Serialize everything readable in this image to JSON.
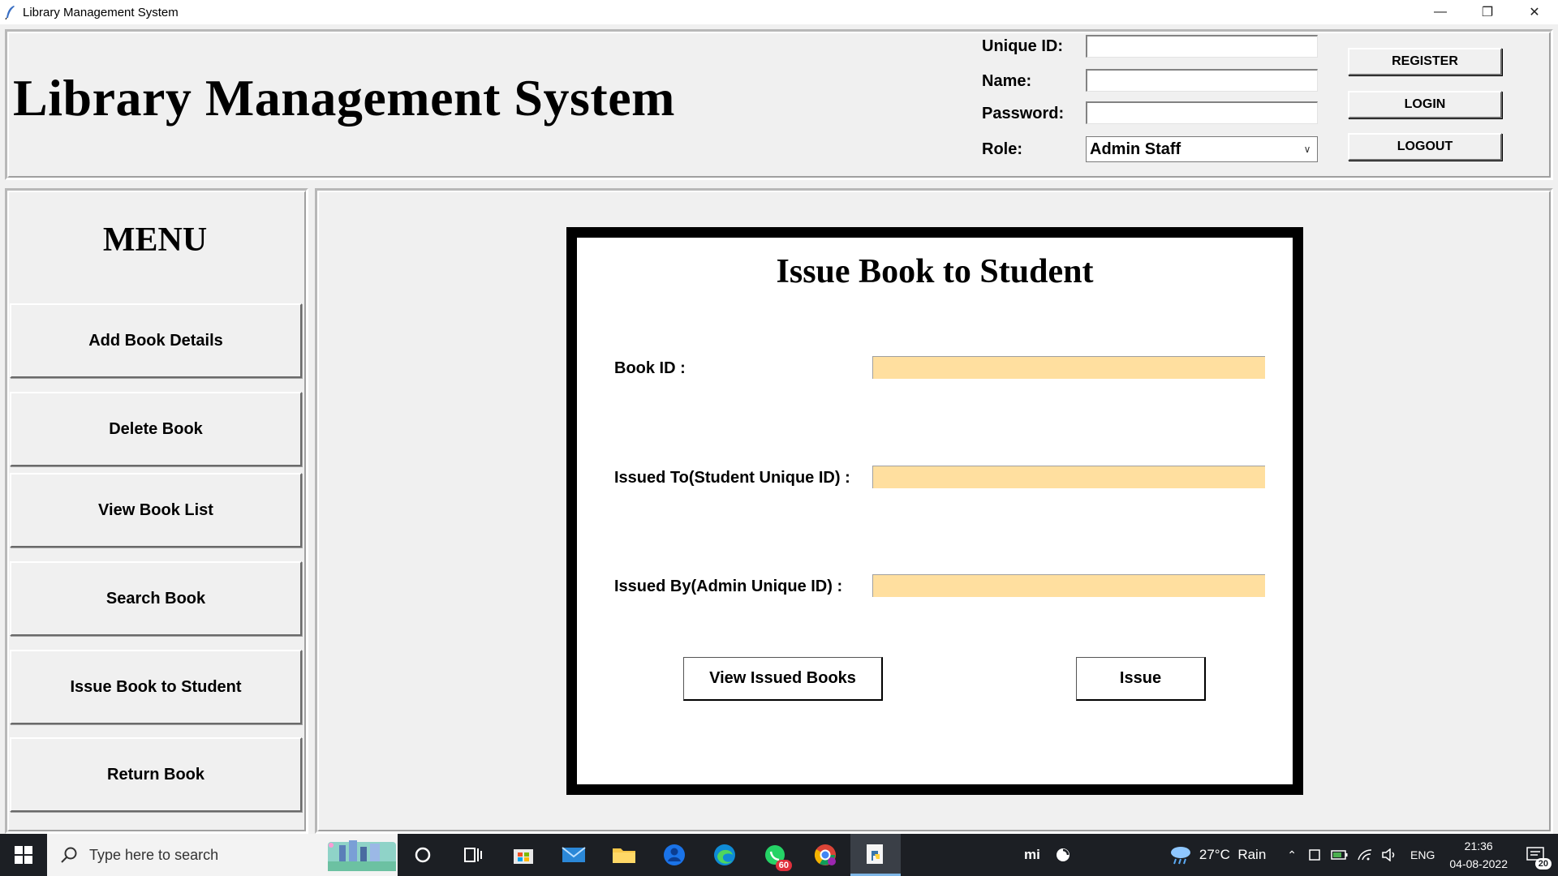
{
  "window": {
    "title": "Library Management System",
    "controls": [
      "—",
      "❐",
      "✕"
    ]
  },
  "header": {
    "app_title": "Library Management System",
    "fields": {
      "unique_id_label": "Unique ID:",
      "unique_id_value": "",
      "name_label": "Name:",
      "name_value": "",
      "password_label": "Password:",
      "password_value": "",
      "role_label": "Role:",
      "role_value": "Admin Staff"
    },
    "buttons": {
      "register": "REGISTER",
      "login": "LOGIN",
      "logout": "LOGOUT"
    }
  },
  "menu": {
    "title": "MENU",
    "items": [
      {
        "label": "Add Book Details"
      },
      {
        "label": "Delete Book"
      },
      {
        "label": "View Book List"
      },
      {
        "label": "Search Book"
      },
      {
        "label": "Issue Book to Student"
      },
      {
        "label": "Return Book"
      }
    ]
  },
  "issue_panel": {
    "title": "Issue Book to Student",
    "book_id_label": "Book ID :",
    "book_id_value": "",
    "issued_to_label": "Issued To(Student Unique ID) :",
    "issued_to_value": "",
    "issued_by_label": "Issued By(Admin Unique ID) :",
    "issued_by_value": "",
    "view_issued_button": "View Issued Books",
    "issue_button": "Issue",
    "field_color": "#ffdf9f"
  },
  "taskbar": {
    "search_placeholder": "Type here to search",
    "whatsapp_badge": "60",
    "mi_label": "mi",
    "weather": "27°C  Rain",
    "language": "ENG",
    "time": "21:36",
    "date": "04-08-2022",
    "notifications": "20",
    "icons": [
      "windows-start-icon",
      "search-icon",
      "cortana-icon",
      "task-view-icon",
      "store-icon",
      "mail-icon",
      "file-explorer-icon",
      "person-app-icon",
      "edge-icon",
      "whatsapp-icon",
      "chrome-icon",
      "python-idle-icon"
    ]
  }
}
